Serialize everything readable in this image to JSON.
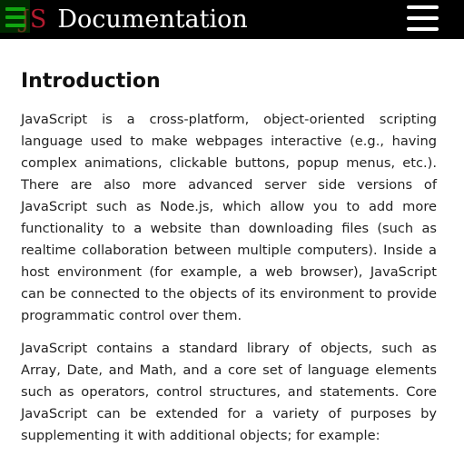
{
  "header": {
    "logo_text": "JS",
    "title": "Documentation",
    "left_menu_icon": "hamburger-menu-icon",
    "right_menu_icon": "hamburger-menu-icon"
  },
  "colors": {
    "header_bg": "#000000",
    "logo": "#b31b2f",
    "left_menu_bars": "#11a611",
    "right_menu_bars": "#ffffff"
  },
  "main": {
    "heading": "Introduction",
    "paragraphs": [
      "JavaScript is a cross-platform, object-oriented scripting language used to make webpages interactive (e.g., having complex animations, clickable buttons, popup menus, etc.). There are also more advanced server side versions of JavaScript such as Node.js, which allow you to add more functionality to a website than downloading files (such as realtime collaboration between multiple computers). Inside a host environment (for example, a web browser), JavaScript can be connected to the objects of its environment to provide programmatic control over them.",
      "JavaScript contains a standard library of objects, such as Array, Date, and Math, and a core set of language elements such as operators, control structures, and statements. Core JavaScript can be extended for a variety of purposes by supplementing it with additional objects; for example:"
    ]
  }
}
